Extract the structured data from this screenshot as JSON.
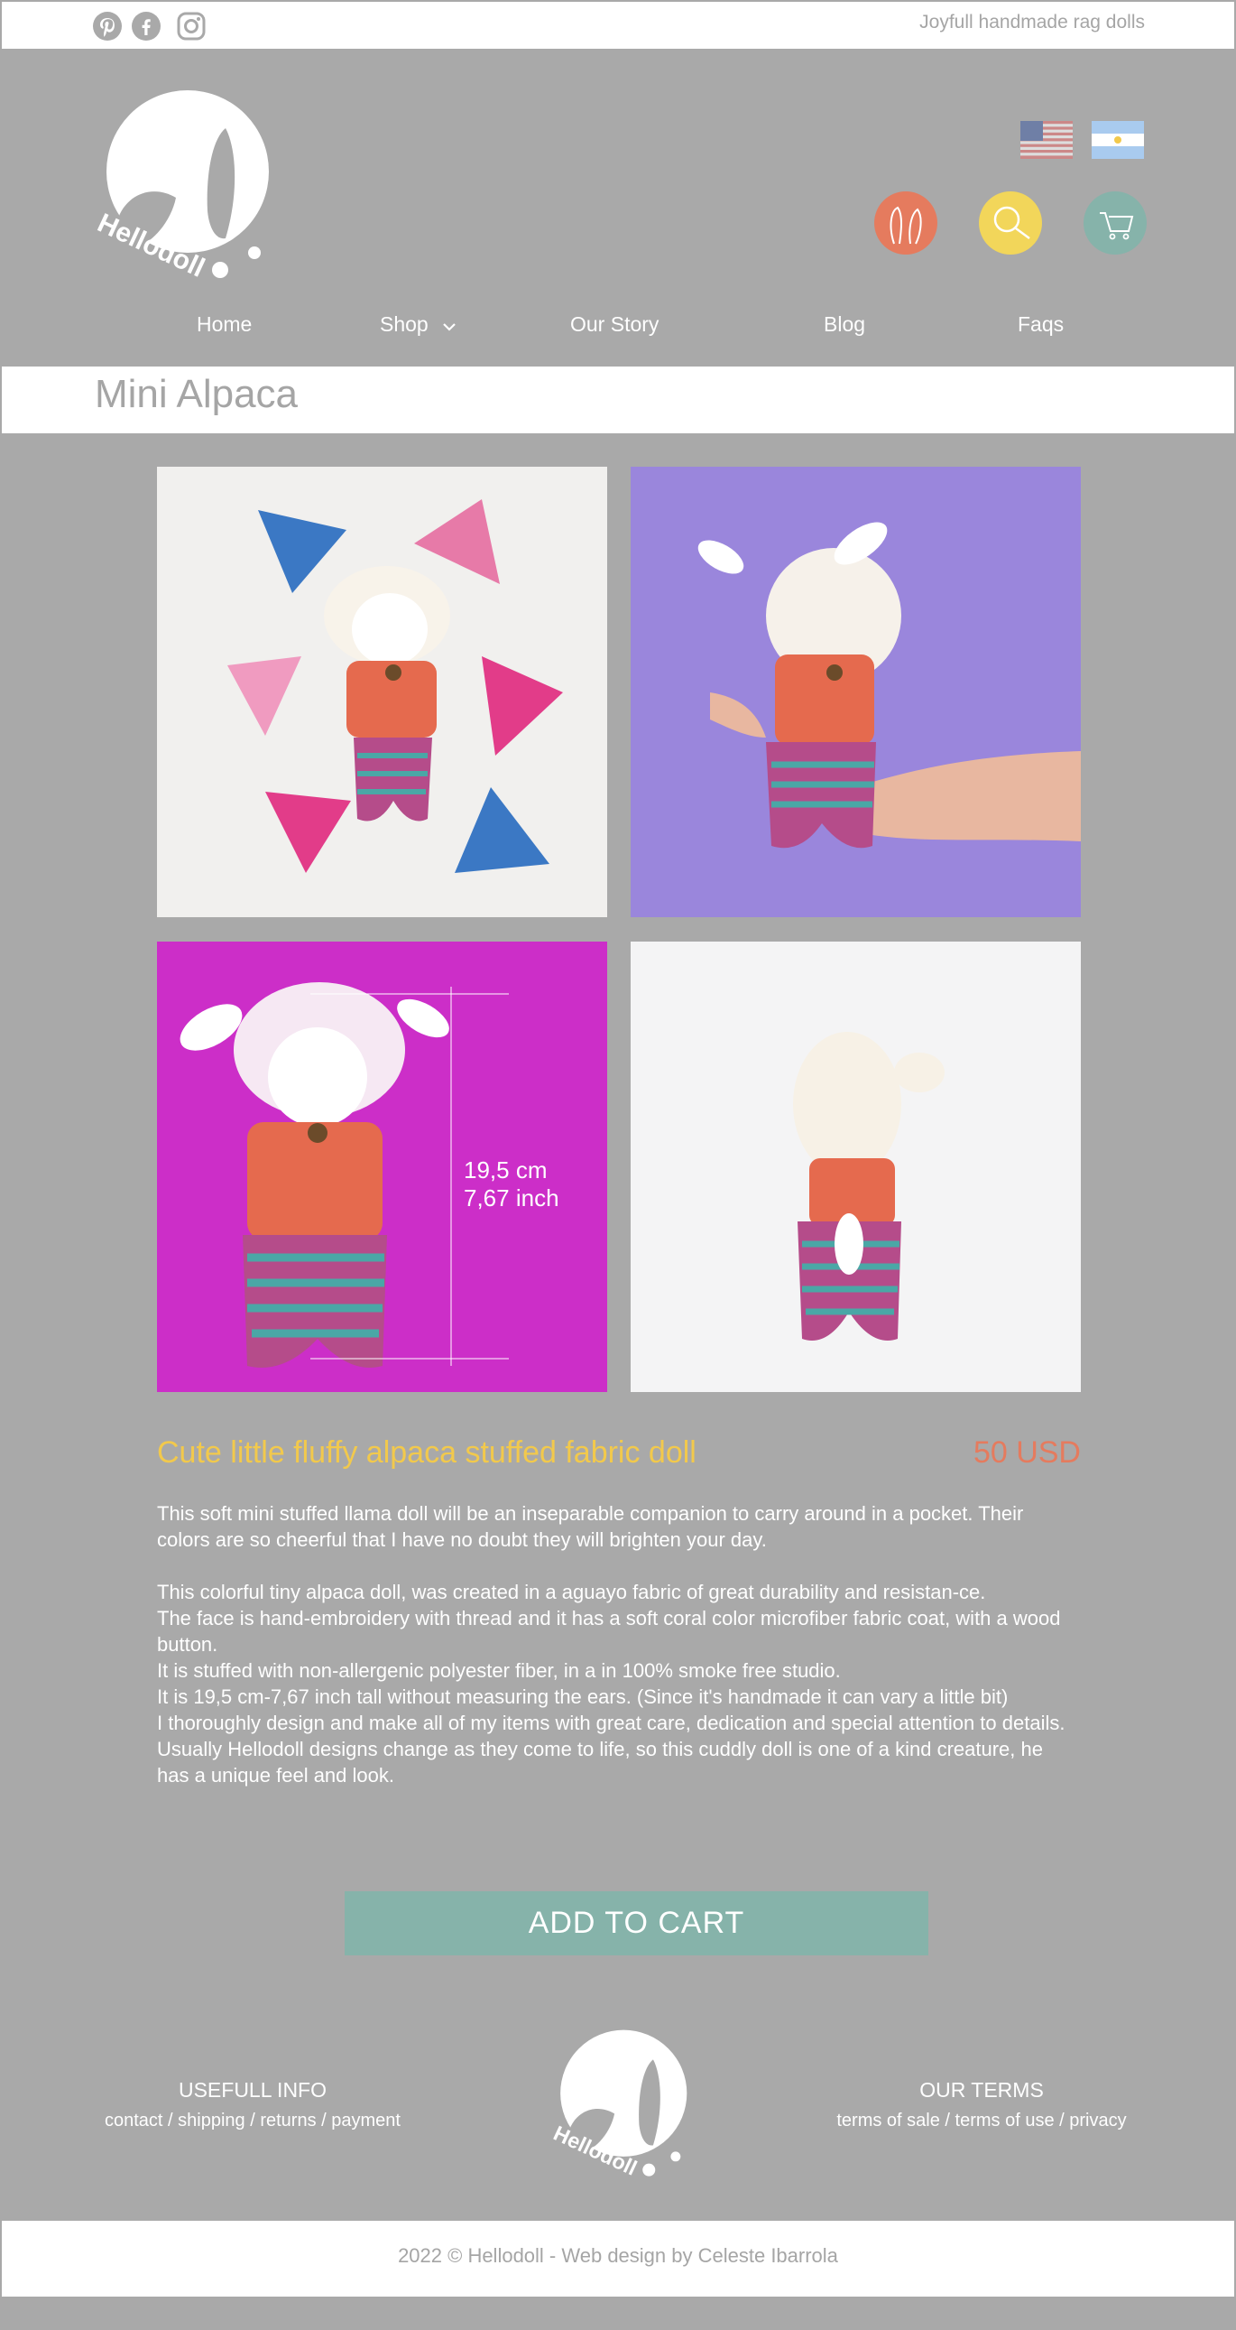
{
  "topbar": {
    "social_icons": [
      "pinterest-icon",
      "facebook-icon",
      "instagram-icon"
    ],
    "tagline": "Joyfull handmade rag dolls"
  },
  "header": {
    "logo_text": "Hellodoll",
    "flags": [
      "us-flag-icon",
      "argentina-flag-icon"
    ],
    "action_icons": [
      {
        "name": "bunny-ears-icon",
        "color": "#e57b5e"
      },
      {
        "name": "search-icon",
        "color": "#f2d65a"
      },
      {
        "name": "cart-icon",
        "color": "#86b3aa"
      }
    ]
  },
  "nav": {
    "items": [
      {
        "label": "Home"
      },
      {
        "label": "Shop",
        "icon": "chevron-down-icon"
      },
      {
        "label": "Our Story"
      },
      {
        "label": "Blog"
      },
      {
        "label": "Faqs"
      }
    ]
  },
  "page": {
    "title": "Mini Alpaca"
  },
  "gallery": {
    "measure_cm": "19,5 cm",
    "measure_inch": "7,67 inch"
  },
  "product": {
    "title": "Cute little fluffy alpaca stuffed fabric doll",
    "price": "50 USD",
    "desc_1": "This soft mini stuffed llama doll will be an inseparable companion to carry around in a pocket. Their colors are so cheerful that I have no doubt they will brighten your day.",
    "desc_2": "This colorful tiny alpaca doll, was created in a aguayo fabric of great durability and resistan-ce.",
    "desc_3": "The face is hand-embroidery with thread and it has a soft coral color microfiber fabric coat, with a wood button.",
    "desc_4": "It is stuffed with non-allergenic polyester fiber, in a in 100% smoke free studio.",
    "desc_5": "It is 19,5 cm-7,67 inch tall without measuring the ears. (Since it's handmade it can vary a little bit)",
    "desc_6": "I thoroughly design and make all of my items with great care, dedication and special attention to details. Usually Hellodoll designs change as they come to life, so this cuddly doll is one of a kind creature, he has a unique feel and look.",
    "add_to_cart": "ADD TO CART"
  },
  "footer": {
    "useful_heading": "USEFULL INFO",
    "useful_links": [
      "contact",
      "shipping",
      "returns",
      "payment"
    ],
    "terms_heading": "OUR TERMS",
    "terms_links": [
      "terms of sale",
      "terms of use",
      "privacy"
    ],
    "logo_text": "Hellodoll",
    "copyright": "2022 © Hellodoll - Web design by Celeste Ibarrola"
  }
}
